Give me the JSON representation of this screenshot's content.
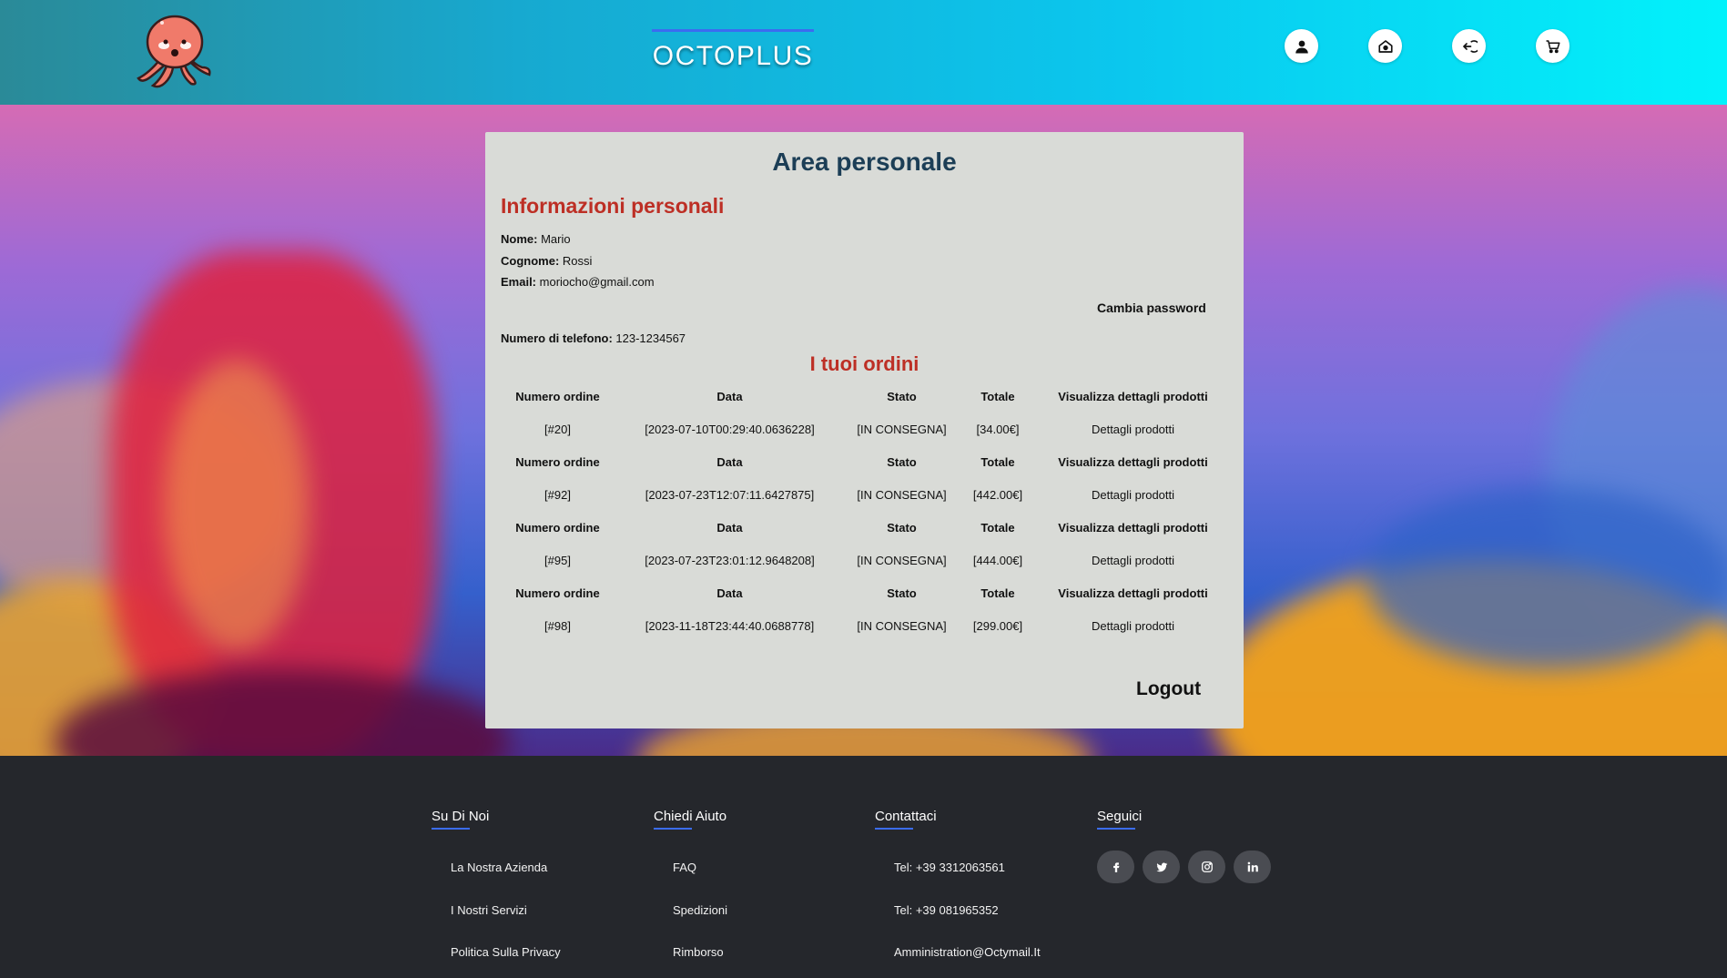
{
  "header": {
    "brand": "OCTOPLUS",
    "icons": [
      "user-icon",
      "home-icon",
      "logout-icon",
      "cart-icon"
    ]
  },
  "card": {
    "title": "Area personale",
    "info_title": "Informazioni personali",
    "info": {
      "nome_label": "Nome:",
      "nome": "Mario",
      "cognome_label": "Cognome:",
      "cognome": "Rossi",
      "email_label": "Email:",
      "email": "moriocho@gmail.com",
      "telefono_label": "Numero di telefono:",
      "telefono": "123-1234567"
    },
    "cambia_password": "Cambia password",
    "orders_title": "I tuoi ordini",
    "orders_headers": [
      "Numero ordine",
      "Data",
      "Stato",
      "Totale",
      "Visualizza dettagli prodotti"
    ],
    "orders": [
      {
        "numero": "[#20]",
        "data": "[2023-07-10T00:29:40.0636228]",
        "stato": "[IN CONSEGNA]",
        "totale": "[34.00€]",
        "dettagli": "Dettagli prodotti"
      },
      {
        "numero": "[#92]",
        "data": "[2023-07-23T12:07:11.6427875]",
        "stato": "[IN CONSEGNA]",
        "totale": "[442.00€]",
        "dettagli": "Dettagli prodotti"
      },
      {
        "numero": "[#95]",
        "data": "[2023-07-23T23:01:12.9648208]",
        "stato": "[IN CONSEGNA]",
        "totale": "[444.00€]",
        "dettagli": "Dettagli prodotti"
      },
      {
        "numero": "[#98]",
        "data": "[2023-11-18T23:44:40.0688778]",
        "stato": "[IN CONSEGNA]",
        "totale": "[299.00€]",
        "dettagli": "Dettagli prodotti"
      }
    ],
    "logout": "Logout"
  },
  "footer": {
    "columns": [
      {
        "title": "Su Di Noi",
        "links": [
          "La Nostra Azienda",
          "I Nostri Servizi",
          "Politica Sulla Privacy"
        ]
      },
      {
        "title": "Chiedi Aiuto",
        "links": [
          "FAQ",
          "Spedizioni",
          "Rimborso"
        ]
      },
      {
        "title": "Contattaci",
        "links": [
          "Tel: +39 3312063561",
          "Tel: +39 081965352",
          "Amministration@Octymail.It"
        ]
      },
      {
        "title": "Seguici",
        "social": [
          "facebook-icon",
          "twitter-icon",
          "instagram-icon",
          "linkedin-icon"
        ]
      }
    ]
  },
  "colors": {
    "accent": "#3b6cf0",
    "section_red": "#bd2f25",
    "title_blue": "#1c3e56",
    "card_bg": "#d9dbd7",
    "footer_bg": "#25272c"
  }
}
